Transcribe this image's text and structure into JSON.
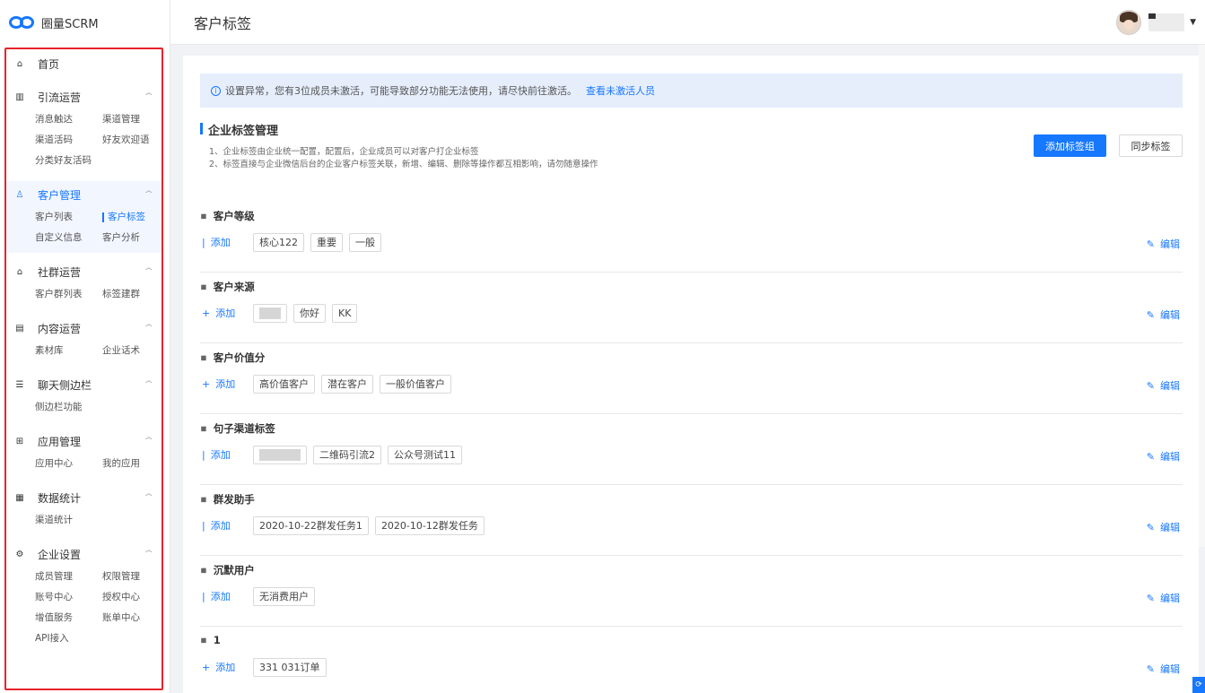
{
  "brand": {
    "name": "圈量SCRM",
    "accent": "#1677ff",
    "frame": "#e8232a"
  },
  "header": {
    "title": "客户标签"
  },
  "sidebar": {
    "home": "首页",
    "groups": [
      {
        "label": "引流运营",
        "icon": "chart-icon",
        "items": [
          "消息触达",
          "渠道管理",
          "渠道活码",
          "好友欢迎语",
          "分类好友活码"
        ]
      },
      {
        "label": "客户管理",
        "icon": "user-icon",
        "active": true,
        "items": [
          "客户列表",
          "客户标签",
          "自定义信息",
          "客户分析"
        ]
      },
      {
        "label": "社群运营",
        "icon": "home-icon",
        "items": [
          "客户群列表",
          "标签建群"
        ]
      },
      {
        "label": "内容运营",
        "icon": "doc-icon",
        "items": [
          "素材库",
          "企业话术"
        ]
      },
      {
        "label": "聊天侧边栏",
        "icon": "list-icon",
        "items": [
          "侧边栏功能"
        ]
      },
      {
        "label": "应用管理",
        "icon": "apps-icon",
        "items": [
          "应用中心",
          "我的应用"
        ]
      },
      {
        "label": "数据统计",
        "icon": "stats-icon",
        "items": [
          "渠道统计"
        ]
      },
      {
        "label": "企业设置",
        "icon": "gear-icon",
        "items": [
          "成员管理",
          "权限管理",
          "账号中心",
          "授权中心",
          "增值服务",
          "账单中心",
          "API接入"
        ]
      }
    ]
  },
  "alert": {
    "text": "设置异常，您有3位成员未激活，可能导致部分功能无法使用，请尽快前往激活。",
    "link": "查看未激活人员"
  },
  "section": {
    "title": "企业标签管理",
    "desc1": "1、企业标签由企业统一配置，配置后，企业成员可以对客户打企业标签",
    "desc2": "2、标签直接与企业微信后台的企业客户标签关联，新增、编辑、删除等操作都互相影响，请勿随意操作",
    "add_group": "添加标签组",
    "sync": "同步标签"
  },
  "labels": {
    "add": "添加",
    "edit": "编辑"
  },
  "tag_groups": [
    {
      "name": "客户等级",
      "add_mark": "|",
      "tags": [
        "核心122",
        "重要",
        "一般"
      ]
    },
    {
      "name": "客户来源",
      "add_mark": "+",
      "tags": [
        "",
        "你好",
        "KK"
      ]
    },
    {
      "name": "客户价值分",
      "add_mark": "+",
      "tags": [
        "高价值客户",
        "潜在客户",
        "一般价值客户"
      ]
    },
    {
      "name": "句子渠道标签",
      "add_mark": "|",
      "tags": [
        "",
        "二维码引流2",
        "公众号测试11"
      ]
    },
    {
      "name": "群发助手",
      "add_mark": "|",
      "tags": [
        "2020-10-22群发任务1",
        "2020-10-12群发任务"
      ]
    },
    {
      "name": "沉默用户",
      "add_mark": "|",
      "tags": [
        "无消费用户"
      ]
    },
    {
      "name": "1",
      "add_mark": "+",
      "tags": [
        "331 031订单"
      ]
    }
  ]
}
